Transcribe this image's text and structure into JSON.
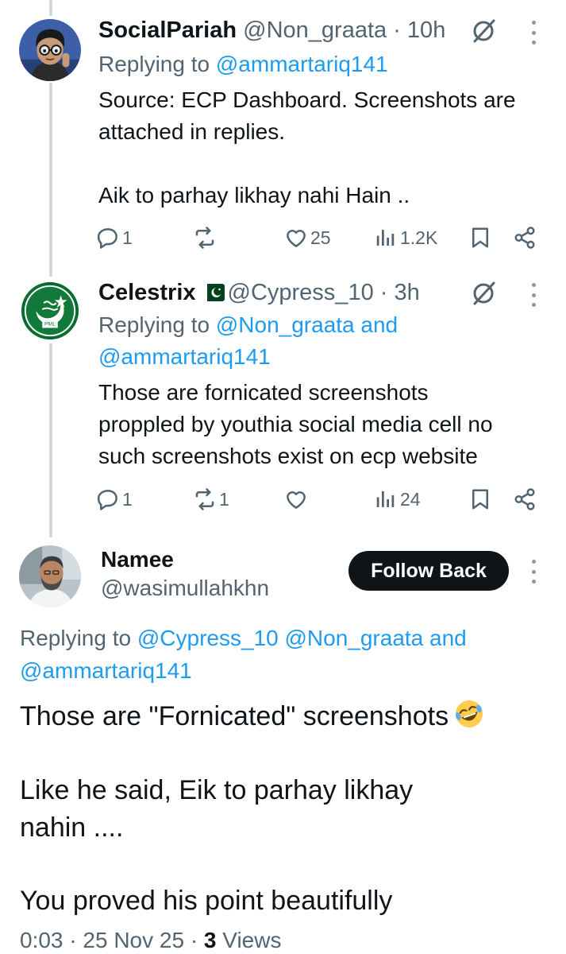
{
  "tweets": [
    {
      "display_name": "SocialPariah",
      "handle": "@Non_graata",
      "time": "· 10h",
      "replying_prefix": "Replying to",
      "mentions": [
        "@ammartariq141"
      ],
      "text": "Source: ECP Dashboard. Screenshots are\nattached in replies.\n\nAik to parhay likhay nahi Hain ..",
      "stats": {
        "replies": "1",
        "retweets": "",
        "likes": "25",
        "views": "1.2K"
      }
    },
    {
      "display_name": "Celestrix",
      "handle": "@Cypress_10",
      "time": "· 3h",
      "replying_prefix": "Replying to",
      "mentions": [
        "@Non_graata and",
        "@ammartariq141"
      ],
      "text": "Those are fornicated screenshots\nproppled by youthia social media cell no\nsuch screenshots exist on ecp website",
      "stats": {
        "replies": "1",
        "retweets": "1",
        "likes": "",
        "views": "24"
      }
    }
  ],
  "main_tweet": {
    "display_name": "Namee",
    "handle": "@wasimullahkhn",
    "follow_label": "Follow Back",
    "replying_prefix": "Replying to",
    "mentions_line1": "@Cypress_10 @Non_graata and",
    "mentions_line2": "@ammartariq141",
    "line1": "Those are \"Fornicated\" screenshots",
    "line2": "Like he said, Eik to parhay likhay",
    "line3": "nahin ....",
    "line4": "You proved his point beautifully",
    "time": "0:03",
    "date": "25 Nov 25",
    "views_count": "3",
    "views_label": "Views",
    "separator": "·"
  },
  "icons": [
    "grok-icon",
    "more-icon",
    "reply-icon",
    "retweet-icon",
    "like-icon",
    "views-icon",
    "bookmark-icon",
    "share-icon",
    "laughing-emoji",
    "pakistan-flag"
  ],
  "colors": {
    "link": "#1d9bf0",
    "secondary": "#536471",
    "primary_text": "#0f1419",
    "thread_line": "#cfd9de"
  }
}
